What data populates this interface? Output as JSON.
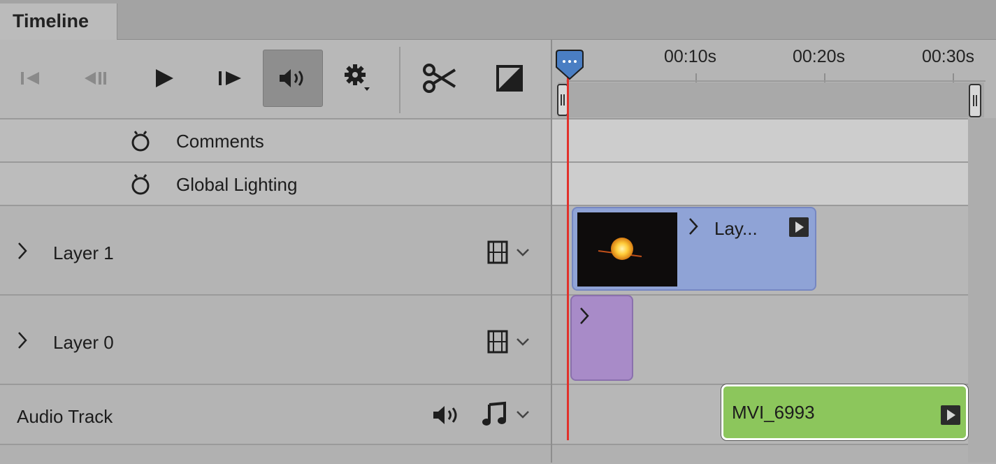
{
  "window": {
    "tab_label": "Timeline"
  },
  "toolbar": {
    "buttons": [
      {
        "name": "go-to-first-frame-icon"
      },
      {
        "name": "previous-frame-icon"
      },
      {
        "name": "play-icon"
      },
      {
        "name": "next-frame-icon"
      },
      {
        "name": "mute-audio-icon",
        "active": true
      },
      {
        "name": "settings-gear-icon"
      },
      {
        "name": "split-at-playhead-icon"
      },
      {
        "name": "transition-icon"
      }
    ]
  },
  "ruler": {
    "ticks": [
      "00:10s",
      "00:20s",
      "00:30s"
    ]
  },
  "tracks": {
    "comments": {
      "label": "Comments"
    },
    "global_lighting": {
      "label": "Global Lighting"
    },
    "layer1": {
      "label": "Layer 1",
      "clip_label": "Lay..."
    },
    "layer0": {
      "label": "Layer 0"
    },
    "audio": {
      "label": "Audio Track",
      "clip_label": "MVI_6993"
    }
  },
  "colors": {
    "video_clip": "#8fa3d6",
    "group_clip": "#a88bc8",
    "audio_clip": "#8cc65c",
    "playhead": "#e2302a",
    "playhead_handle": "#4a7ec3"
  }
}
